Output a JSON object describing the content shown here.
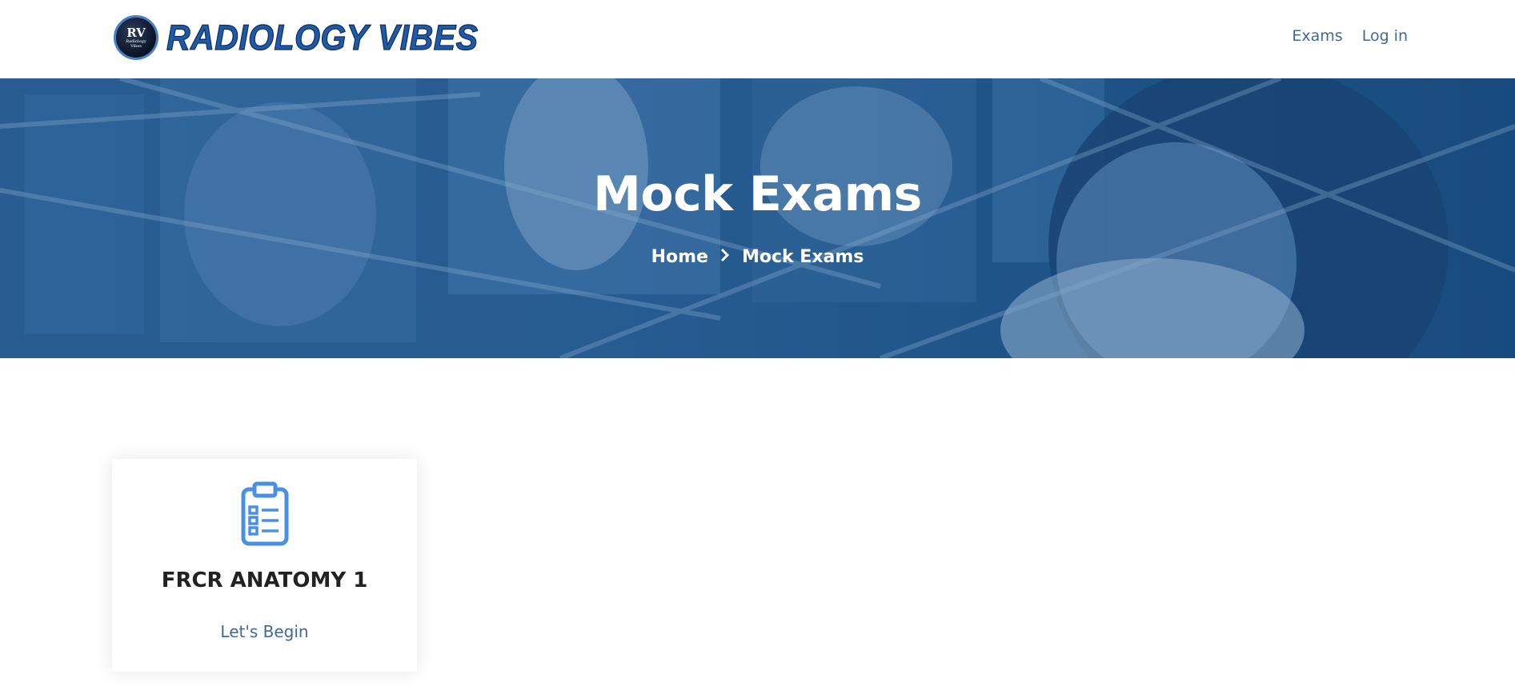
{
  "header": {
    "logo_badge_text": "RV",
    "logo_badge_subtext": "Radiology Vibes",
    "logo_text": "RADIOLOGY VIBES",
    "nav": [
      {
        "label": "Exams"
      },
      {
        "label": "Log in"
      }
    ]
  },
  "hero": {
    "title": "Mock Exams",
    "breadcrumb": [
      {
        "label": "Home"
      },
      {
        "label": "Mock Exams"
      }
    ],
    "separator_icon": "chevron-right-icon"
  },
  "cards": [
    {
      "icon": "clipboard-checklist-icon",
      "title": "FRCR ANATOMY 1",
      "action_label": "Let's Begin"
    }
  ],
  "colors": {
    "brand": "#1f5aa8",
    "nav_link": "#3f6a96",
    "hero_overlay": "#2a5f95",
    "icon": "#4a90e2",
    "title_text": "#222222"
  }
}
